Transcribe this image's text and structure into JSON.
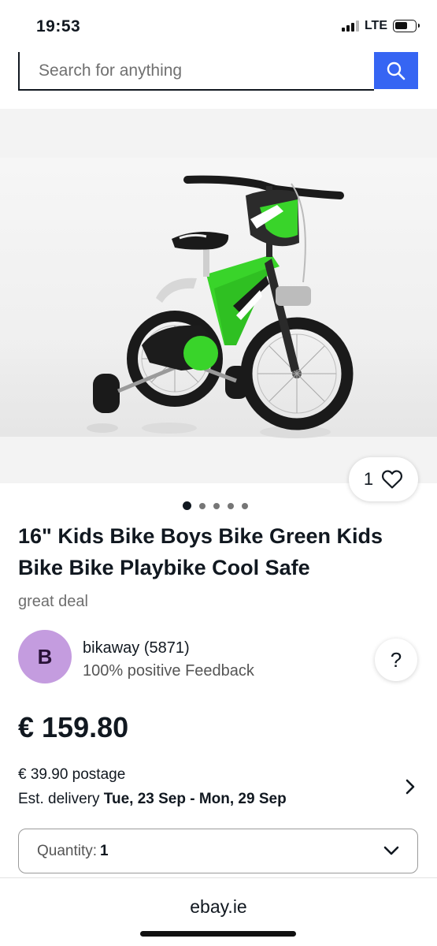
{
  "status_bar": {
    "time": "19:53",
    "network": "LTE"
  },
  "search": {
    "placeholder": "Search for anything"
  },
  "icons": {
    "search": "search-icon",
    "heart": "heart-icon",
    "chevron_right": "chevron-right-icon",
    "chevron_down": "chevron-down-icon",
    "signal": "signal-icon",
    "battery": "battery-icon"
  },
  "gallery": {
    "like_count": "1",
    "image_count": 5,
    "active_index": 0
  },
  "listing": {
    "title": "16\" Kids Bike Boys Bike Green Kids Bike Bike Playbike Cool Safe",
    "subtitle": "great deal",
    "price": "€ 159.80"
  },
  "seller": {
    "initial": "B",
    "name": "bikaway (5871)",
    "feedback": "100% positive Feedback",
    "help_label": "?"
  },
  "shipping": {
    "postage": "€ 39.90 postage",
    "delivery_prefix": "Est. delivery",
    "delivery_dates": "Tue, 23 Sep - Mon, 29 Sep"
  },
  "quantity": {
    "label": "Quantity:",
    "value": "1"
  },
  "footer": {
    "domain": "ebay.ie"
  },
  "colors": {
    "accent": "#3665f3",
    "avatar": "#c49cdf",
    "bike_green": "#39d42a",
    "text": "#111820"
  }
}
